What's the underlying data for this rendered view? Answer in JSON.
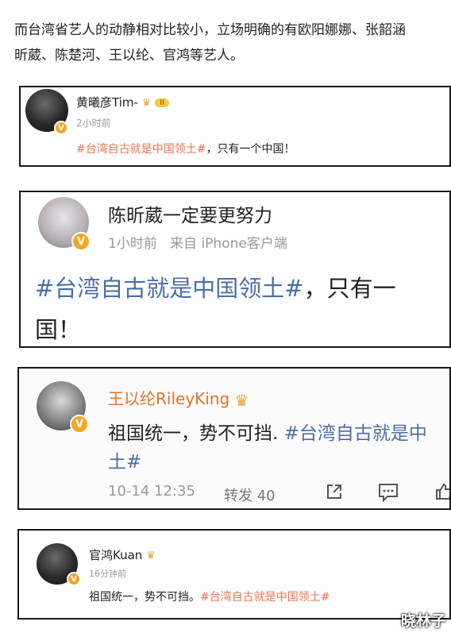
{
  "intro": "而台湾省艺人的动静相对比较小，立场明确的有欧阳娜娜、张韶涵\n昕葳、陈楚河、王以纶、官鸿等艺人。",
  "posts": [
    {
      "author": "黄曦彦Tim-",
      "level_badge": "II",
      "time": "2小时前",
      "hashtag": "#台湾自古就是中国领土#",
      "text_after": "，只有一个中国！"
    },
    {
      "author": "陈昕葳一定要更努力",
      "time": "1小时前",
      "source": "来自 iPhone客户端",
      "hashtag": "#台湾自古就是中国领土#",
      "text_after": "，只有一",
      "line2": "国！"
    },
    {
      "author": "王以纶RileyKing",
      "text_before": "祖国统一，势不可挡. ",
      "hashtag": "#台湾自古就是中",
      "line2": "土#",
      "time": "10-14 12:35",
      "repost": "转发 40"
    },
    {
      "author": "官鸿Kuan",
      "time": "16分钟前",
      "text_before": "祖国统一，势不可挡。",
      "hashtag": "#台湾自古就是中国领土#"
    }
  ],
  "watermark": "晓林子",
  "icons": {
    "verified": "verified-badge-icon",
    "crown": "crown-icon",
    "share": "share-icon",
    "comment": "comment-icon",
    "like": "like-icon"
  },
  "colors": {
    "hashtag_blue": "#4a6fa5",
    "hashtag_orange": "#eb7350",
    "verified": "#f5a623",
    "meta_gray": "#999999"
  }
}
